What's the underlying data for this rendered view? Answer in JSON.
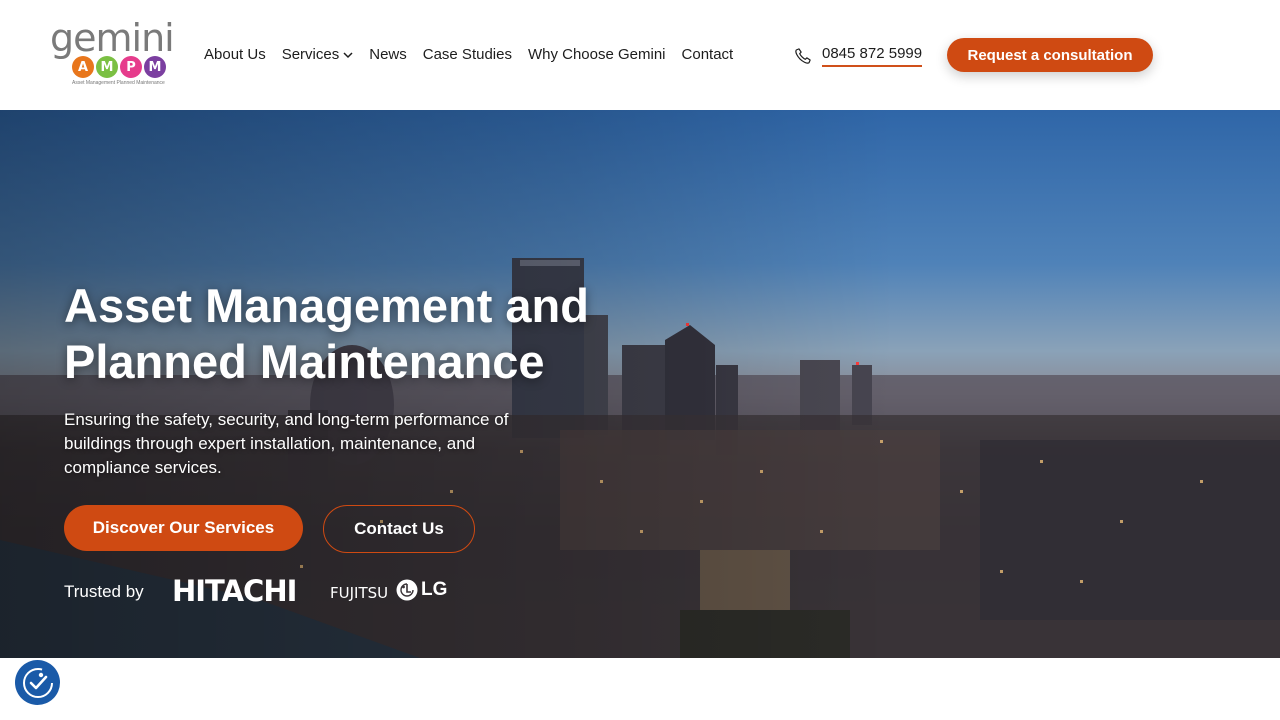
{
  "header": {
    "logo": {
      "wordmark": "gemini",
      "letters": [
        "A",
        "M",
        "P",
        "M"
      ],
      "letter_colors": [
        "#e8761c",
        "#7bc043",
        "#e63c8c",
        "#7b3fa0"
      ],
      "tagline": "Asset Management Planned Maintenance"
    },
    "nav": [
      {
        "label": "About Us"
      },
      {
        "label": "Services"
      },
      {
        "label": "News"
      },
      {
        "label": "Case Studies"
      },
      {
        "label": "Why Choose Gemini"
      },
      {
        "label": "Contact"
      }
    ],
    "phone": "0845 872 5999",
    "cta_label": "Request a consultation"
  },
  "hero": {
    "title": "Asset Management and Planned Maintenance",
    "subtitle": "Ensuring the safety, security, and long-term performance of buildings through expert installation, maintenance, and compliance services.",
    "primary_button": "Discover Our Services",
    "secondary_button": "Contact Us",
    "trusted_label": "Trusted by",
    "brands": [
      "HITACHI",
      "FUJITSU",
      "LG"
    ]
  },
  "colors": {
    "accent": "#cf4a12",
    "a11y": "#1a5aa8"
  },
  "icons": {
    "phone": "phone-icon",
    "services_dropdown": "chevron-down-icon",
    "accessibility": "accessibility-icon"
  }
}
